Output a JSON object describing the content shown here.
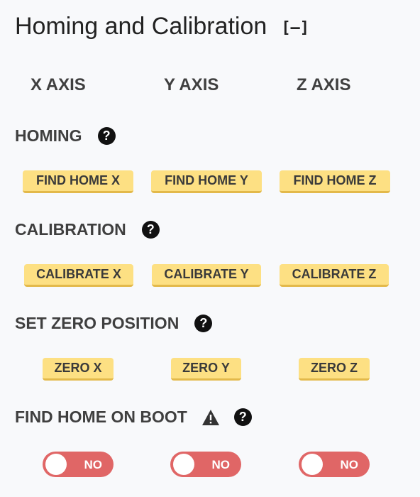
{
  "header": {
    "title": "Homing and Calibration",
    "collapse_label": "[–]"
  },
  "axes": [
    "X AXIS",
    "Y AXIS",
    "Z AXIS"
  ],
  "sections": {
    "homing": {
      "label": "HOMING",
      "buttons": [
        "FIND HOME X",
        "FIND HOME Y",
        "FIND HOME Z"
      ]
    },
    "calibration": {
      "label": "CALIBRATION",
      "buttons": [
        "CALIBRATE X",
        "CALIBRATE Y",
        "CALIBRATE Z"
      ]
    },
    "zero": {
      "label": "SET ZERO POSITION",
      "buttons": [
        "ZERO X",
        "ZERO Y",
        "ZERO Z"
      ]
    },
    "boot": {
      "label": "FIND HOME ON BOOT",
      "toggles": [
        "NO",
        "NO",
        "NO"
      ]
    }
  },
  "icons": {
    "help": "?",
    "help_icon_name": "question-circle-icon",
    "warning_icon_name": "warning-triangle-icon"
  },
  "colors": {
    "button_bg": "#fde083",
    "toggle_off": "#e06666"
  }
}
